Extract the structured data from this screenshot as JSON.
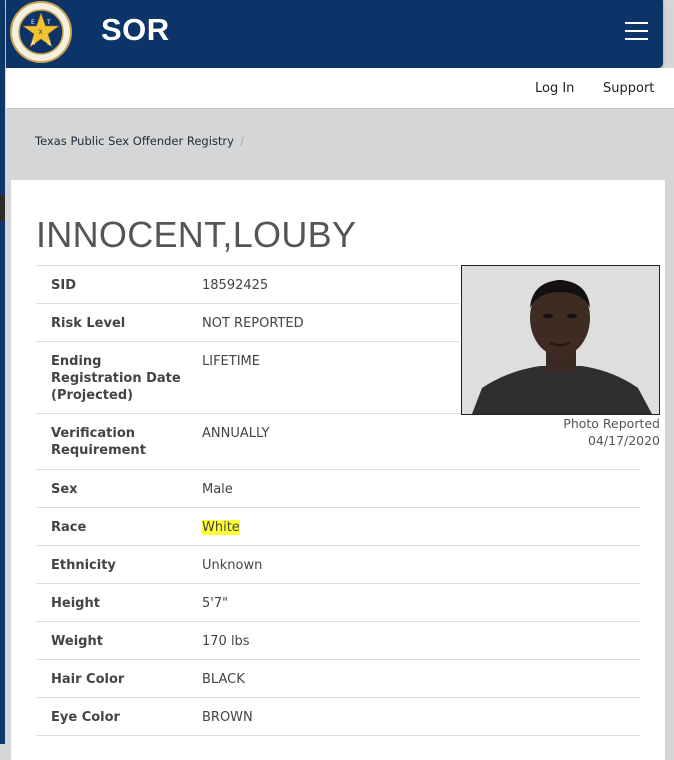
{
  "header": {
    "brand": "SOR",
    "seal_letters": [
      "E",
      "X",
      "T",
      "A",
      "S"
    ]
  },
  "nav": {
    "login": "Log In",
    "support": "Support"
  },
  "breadcrumb": {
    "item": "Texas Public Sex Offender Registry",
    "separator": "/"
  },
  "offender": {
    "name": "INNOCENT,LOUBY",
    "photo_caption_line1": "Photo Reported",
    "photo_caption_line2": "04/17/2020",
    "fields": [
      {
        "label": "SID",
        "value": "18592425"
      },
      {
        "label": "Risk Level",
        "value": "NOT REPORTED"
      },
      {
        "label": "Ending Registration Date (Projected)",
        "value": "LIFETIME"
      },
      {
        "label": "Verification Requirement",
        "value": "ANNUALLY"
      },
      {
        "label": "Sex",
        "value": "Male"
      },
      {
        "label": "Race",
        "value": "White"
      },
      {
        "label": "Ethnicity",
        "value": "Unknown"
      },
      {
        "label": "Height",
        "value": "5'7\""
      },
      {
        "label": "Weight",
        "value": "170 lbs"
      },
      {
        "label": "Hair Color",
        "value": "BLACK"
      },
      {
        "label": "Eye Color",
        "value": "BROWN"
      }
    ]
  },
  "colors": {
    "header": "#0c3468",
    "highlight": "#ffff33"
  }
}
